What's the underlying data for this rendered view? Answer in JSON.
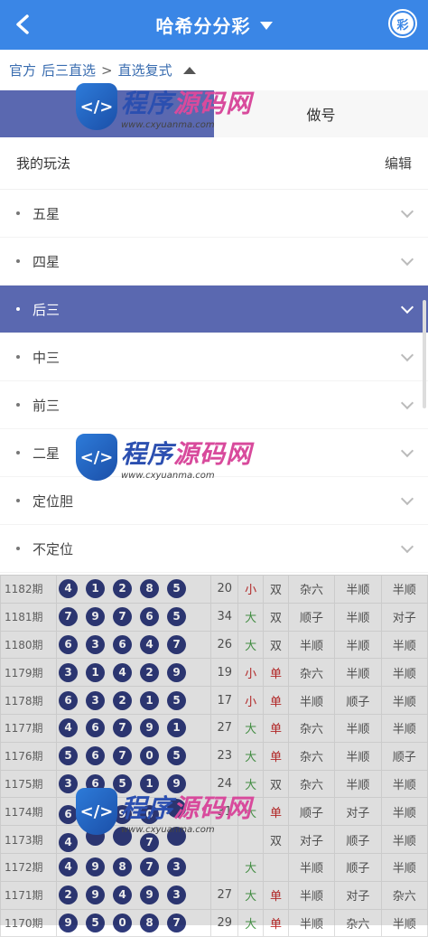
{
  "header": {
    "title": "哈希分分彩",
    "badge": "彩"
  },
  "breadcrumb": {
    "items": [
      "官方",
      "后三直选",
      "直选复式"
    ],
    "sep": ">"
  },
  "tabs": [
    {
      "label": ""
    },
    {
      "label": "做号"
    }
  ],
  "menu": {
    "title": "我的玩法",
    "edit": "编辑",
    "items": [
      {
        "label": "五星",
        "active": false
      },
      {
        "label": "四星",
        "active": false
      },
      {
        "label": "后三",
        "active": true
      },
      {
        "label": "中三",
        "active": false
      },
      {
        "label": "前三",
        "active": false
      },
      {
        "label": "二星",
        "active": false
      },
      {
        "label": "定位胆",
        "active": false
      },
      {
        "label": "不定位",
        "active": false
      }
    ]
  },
  "history": {
    "rows": [
      {
        "period": "1182期",
        "balls": [
          "4",
          "1",
          "2",
          "8",
          "5"
        ],
        "sum": "20",
        "size": "小",
        "oe": "双",
        "f1": "杂六",
        "f2": "半顺",
        "f3": "半顺"
      },
      {
        "period": "1181期",
        "balls": [
          "7",
          "9",
          "7",
          "6",
          "5"
        ],
        "sum": "34",
        "size": "大",
        "oe": "双",
        "f1": "顺子",
        "f2": "半顺",
        "f3": "对子"
      },
      {
        "period": "1180期",
        "balls": [
          "6",
          "3",
          "6",
          "4",
          "7"
        ],
        "sum": "26",
        "size": "大",
        "oe": "双",
        "f1": "半顺",
        "f2": "半顺",
        "f3": "半顺"
      },
      {
        "period": "1179期",
        "balls": [
          "3",
          "1",
          "4",
          "2",
          "9"
        ],
        "sum": "19",
        "size": "小",
        "oe": "单",
        "f1": "杂六",
        "f2": "半顺",
        "f3": "半顺"
      },
      {
        "period": "1178期",
        "balls": [
          "6",
          "3",
          "2",
          "1",
          "5"
        ],
        "sum": "17",
        "size": "小",
        "oe": "单",
        "f1": "半顺",
        "f2": "顺子",
        "f3": "半顺"
      },
      {
        "period": "1177期",
        "balls": [
          "4",
          "6",
          "7",
          "9",
          "1"
        ],
        "sum": "27",
        "size": "大",
        "oe": "单",
        "f1": "杂六",
        "f2": "半顺",
        "f3": "半顺"
      },
      {
        "period": "1176期",
        "balls": [
          "5",
          "6",
          "7",
          "0",
          "5"
        ],
        "sum": "23",
        "size": "大",
        "oe": "单",
        "f1": "杂六",
        "f2": "半顺",
        "f3": "顺子"
      },
      {
        "period": "1175期",
        "balls": [
          "3",
          "6",
          "5",
          "1",
          "9"
        ],
        "sum": "24",
        "size": "大",
        "oe": "双",
        "f1": "杂六",
        "f2": "半顺",
        "f3": "半顺"
      },
      {
        "period": "1174期",
        "balls": [
          "6",
          "",
          "9",
          "0",
          ""
        ],
        "sum": "31",
        "size": "大",
        "oe": "单",
        "f1": "顺子",
        "f2": "对子",
        "f3": "半顺"
      },
      {
        "period": "1173期",
        "balls": [
          "4",
          "",
          "",
          "7",
          ""
        ],
        "sum": "",
        "size": "",
        "oe": "双",
        "f1": "对子",
        "f2": "顺子",
        "f3": "半顺"
      },
      {
        "period": "1172期",
        "balls": [
          "4",
          "9",
          "8",
          "7",
          "3"
        ],
        "sum": "",
        "size": "大",
        "oe": "",
        "f1": "半顺",
        "f2": "顺子",
        "f3": "半顺"
      },
      {
        "period": "1171期",
        "balls": [
          "2",
          "9",
          "4",
          "9",
          "3"
        ],
        "sum": "27",
        "size": "大",
        "oe": "单",
        "f1": "半顺",
        "f2": "对子",
        "f3": "杂六"
      },
      {
        "period": "1170期",
        "balls": [
          "9",
          "5",
          "0",
          "8",
          "7"
        ],
        "sum": "29",
        "size": "大",
        "oe": "单",
        "f1": "半顺",
        "f2": "杂六",
        "f3": "半顺"
      }
    ]
  },
  "watermark": {
    "title_a": "程序",
    "title_b": "源码网",
    "url": "www.cxyuanma.com"
  }
}
